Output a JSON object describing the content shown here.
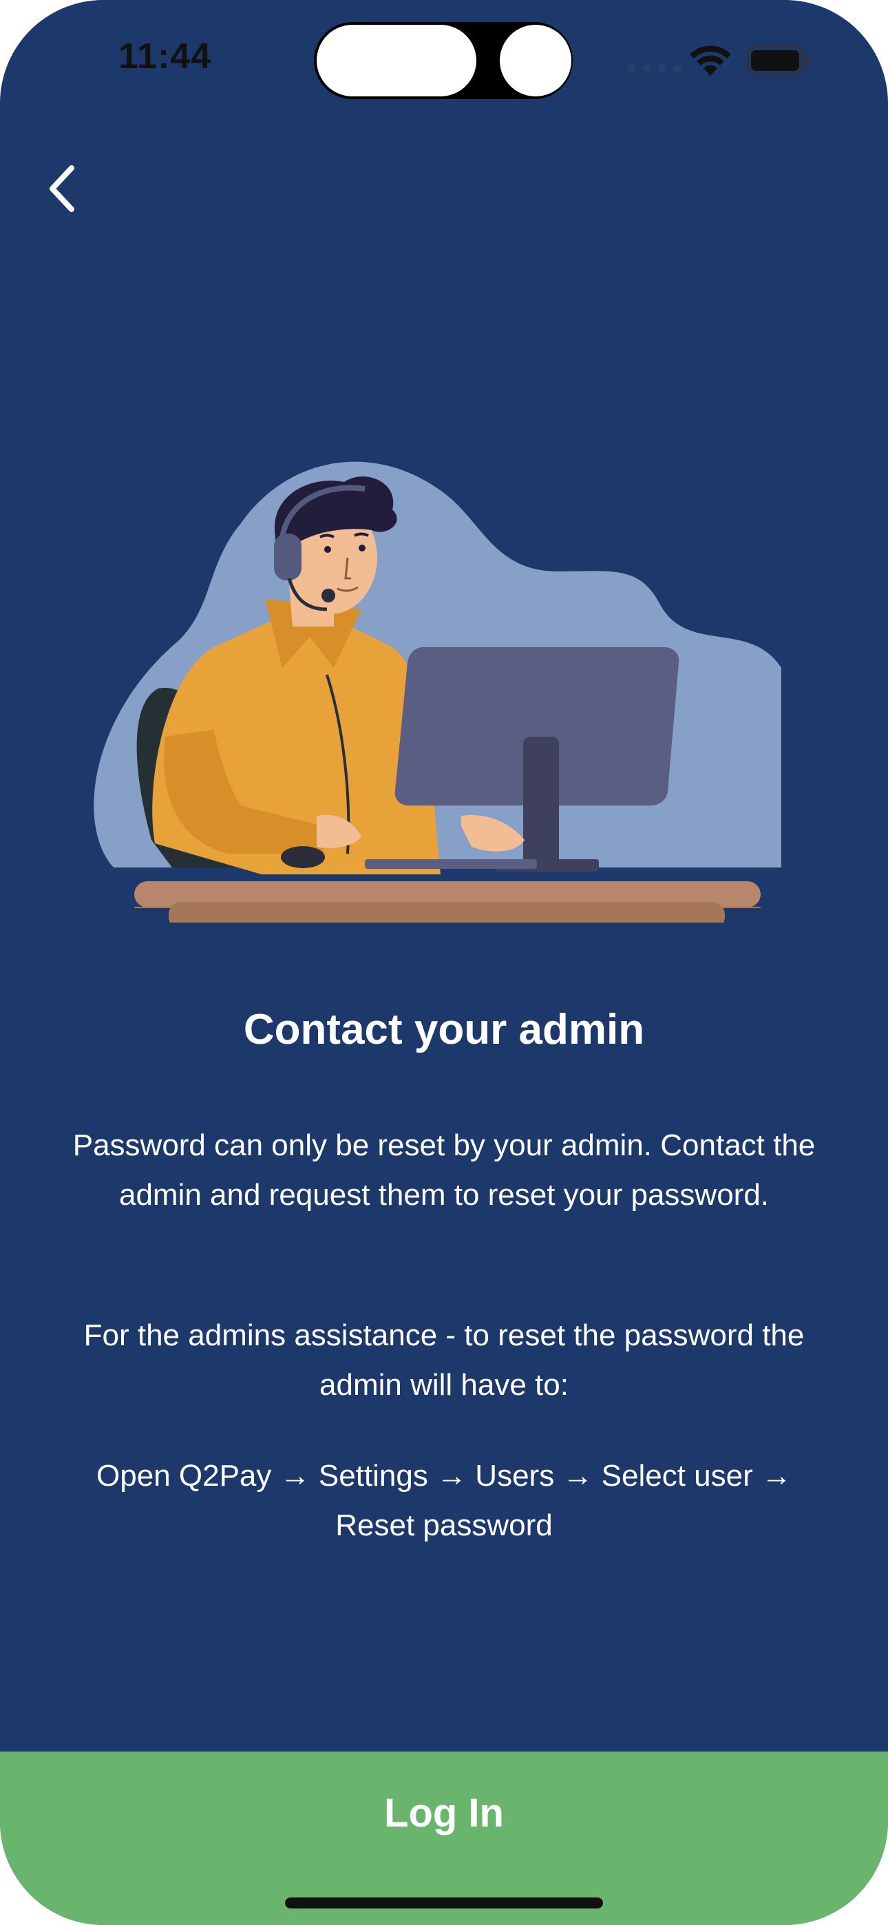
{
  "status_bar": {
    "time": "11:44"
  },
  "icons": {
    "back": "chevron-left-icon",
    "wifi": "wifi-icon",
    "battery": "battery-icon",
    "illustration": "support-agent-illustration"
  },
  "content": {
    "title": "Contact your admin",
    "paragraph_1": "Password can only be reset by your admin. Contact the admin and request them to reset your password.",
    "paragraph_2": "For the admins assistance - to reset the password the admin will have to:",
    "paragraph_3": "Open Q2Pay → Settings → Users → Select user → Reset password"
  },
  "actions": {
    "login_label": "Log In"
  },
  "colors": {
    "background": "#1d386a",
    "login_button": "#6ab56e"
  }
}
